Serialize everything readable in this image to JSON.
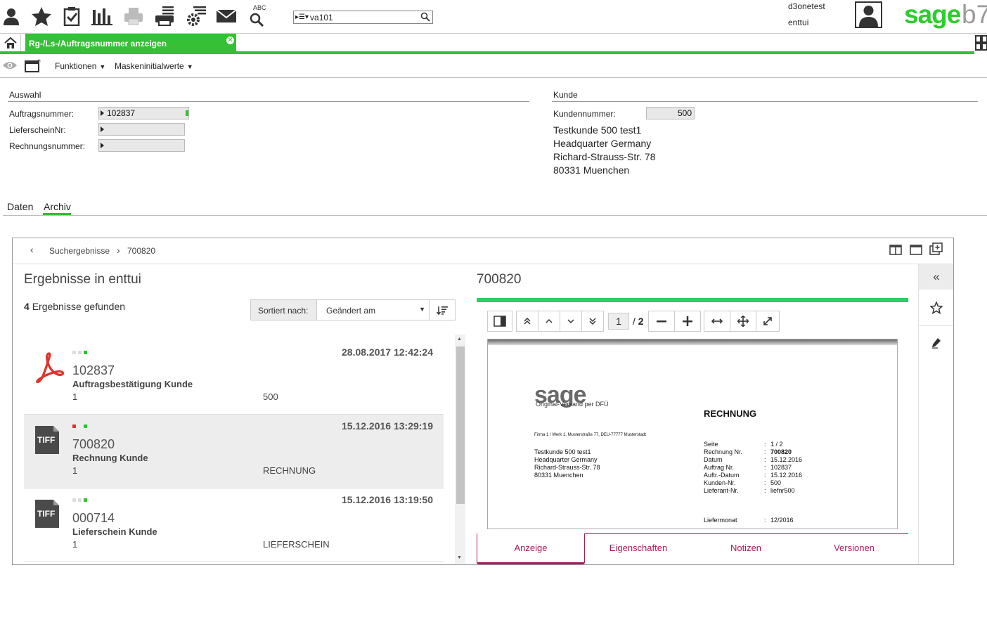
{
  "topbar": {
    "search_prefix": "▸☰▾",
    "search_value": "va101",
    "user_name": "d3onetest",
    "tenant": "enttui",
    "logo_text": "sage",
    "logo_version": "b7",
    "brand_color": "#2ccd2c",
    "abc_label": "ABC"
  },
  "tabs": {
    "active_title": "Rg-/Ls-/Auftragsnummer anzeigen",
    "close_glyph": "✕"
  },
  "toolbar2": {
    "functions_label": "Funktionen",
    "mask_values_label": "Maskeninitialwerte"
  },
  "auswahl": {
    "title": "Auswahl",
    "order_label": "Auftragsnummer:",
    "order_value": "102837",
    "delivery_label": "LieferscheinNr:",
    "delivery_value": "",
    "invoice_label": "Rechnungsnummer:",
    "invoice_value": ""
  },
  "kunde": {
    "title": "Kunde",
    "customer_label": "Kundennummer:",
    "customer_value": "500",
    "address": [
      "Testkunde 500 test1",
      "Headquarter Germany",
      "Richard-Strauss-Str. 78",
      "80331 Muenchen"
    ]
  },
  "datatabs": {
    "daten": "Daten",
    "archiv": "Archiv"
  },
  "archive": {
    "crumb_back": "‹",
    "crumb_results": "Suchergebnisse",
    "crumb_sep": "›",
    "crumb_current": "700820",
    "results_title": "Ergebnisse in enttui",
    "count_number": "4",
    "count_text": "Ergebnisse gefunden",
    "sort_label": "Sortiert nach:",
    "sort_value": "Geändert am",
    "results": [
      {
        "icon": "pdf-icon",
        "date": "28.08.2017 12:42:24",
        "number": "102837",
        "type": "Auftragsbestätigung Kunde",
        "field_a": "1",
        "field_b": "500",
        "dots": [
          "#dddddd",
          "#dddddd",
          "#35c035"
        ]
      },
      {
        "icon": "tiff-icon",
        "icon_label": "TIFF",
        "date": "15.12.2016 13:29:19",
        "number": "700820",
        "type": "Rechnung Kunde",
        "field_a": "1",
        "field_b": "RECHNUNG",
        "dots": [
          "#e0322b",
          "#ededed",
          "#35c035"
        ]
      },
      {
        "icon": "tiff-icon",
        "icon_label": "TIFF",
        "date": "15.12.2016 13:19:50",
        "number": "000714",
        "type": "Lieferschein Kunde",
        "field_a": "1",
        "field_b": "LIEFERSCHEIN",
        "dots": [
          "#dddddd",
          "#dddddd",
          "#35c035"
        ]
      }
    ]
  },
  "viewer": {
    "doc_title": "700820",
    "progress_color": "#2dcd67",
    "page_current": "1",
    "page_sep": "/",
    "page_total": "2",
    "tabs": [
      "Anzeige",
      "Eigenschaften",
      "Notizen",
      "Versionen"
    ],
    "tab_color": "#a51e5b"
  },
  "preview": {
    "logo": "sage",
    "logo_sub": "Original-Versand per DFÜ",
    "heading": "RECHNUNG",
    "sender": "Firma 1 / Werk 1, Musterstraße 77, DEU-77777 Musterstadt",
    "recipient": [
      "Testkunde 500 test1",
      "Headquarter Germany",
      "Richard-Strauss-Str. 78",
      "80331 Muenchen"
    ],
    "meta": [
      {
        "k": "Seite",
        "v": "1 / 2"
      },
      {
        "k": "Rechnung Nr.",
        "v": "700820"
      },
      {
        "k": "Datum",
        "v": "15.12.2016"
      },
      {
        "k": "Auftrag Nr.",
        "v": "102837"
      },
      {
        "k": "Auftr.-Datum",
        "v": "15.12.2016"
      },
      {
        "k": "Kunden-Nr.",
        "v": "500"
      },
      {
        "k": "Lieferant-Nr.",
        "v": "liefnr500"
      }
    ],
    "month_label": "Liefermonat",
    "month_value": "12/2016"
  }
}
